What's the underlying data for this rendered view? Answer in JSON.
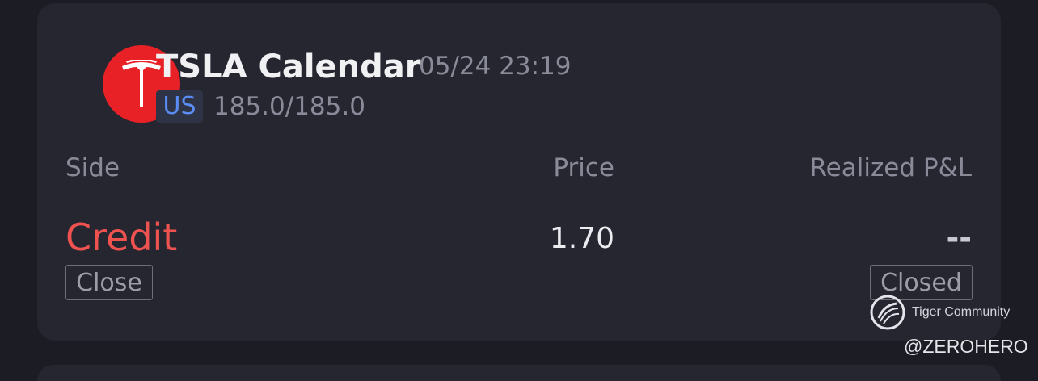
{
  "order": {
    "logo_icon": "tesla-logo-icon",
    "title": "TSLA Calendar",
    "timestamp": "05/24 23:19",
    "market": "US",
    "quote": "185.0/185.0"
  },
  "columns": {
    "side": "Side",
    "price": "Price",
    "pnl": "Realized P&L"
  },
  "values": {
    "side": "Credit",
    "price": "1.70",
    "pnl": "--",
    "side_tag": "Close",
    "status_tag": "Closed"
  },
  "watermark": {
    "community": "Tiger Community",
    "handle": "@ZEROHERO"
  },
  "colors": {
    "background": "#1c1c24",
    "card": "#262631",
    "brand_red": "#e82127",
    "credit_red": "#ef5350",
    "market_blue": "#5b8cf5"
  }
}
